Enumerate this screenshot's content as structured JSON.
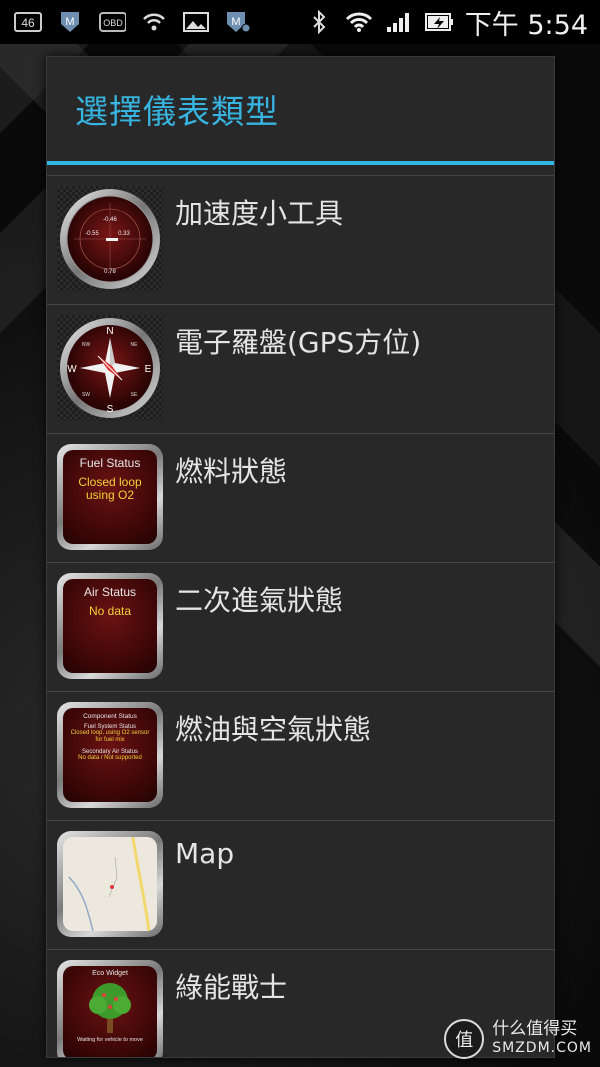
{
  "status_bar": {
    "icons_left": [
      "lte-icon",
      "m-app-icon",
      "obd-icon",
      "wifi-question-icon",
      "image-icon",
      "m-app-badge-icon"
    ],
    "obd_label": "OBD",
    "lte_label": "46",
    "icons_right": [
      "bluetooth-icon",
      "wifi-icon",
      "signal-icon",
      "battery-charging-icon"
    ],
    "time": "下午 5:54"
  },
  "dialog": {
    "title": "選擇儀表類型",
    "items": [
      {
        "label": "加速度小工具",
        "thumb": "accelerometer-gauge",
        "gauge_values": [
          "-0.46",
          "-0.55",
          "0.33",
          "0.78"
        ]
      },
      {
        "label": "電子羅盤(GPS方位)",
        "thumb": "compass-gauge",
        "compass": {
          "n": "N",
          "e": "E",
          "s": "S",
          "w": "W",
          "nw": "NW",
          "ne": "NE",
          "sw": "SW",
          "se": "SE"
        }
      },
      {
        "label": "燃料狀態",
        "thumb": "fuel-status-gauge",
        "gauge_title": "Fuel Status",
        "gauge_text": "Closed loop using O2"
      },
      {
        "label": "二次進氣狀態",
        "thumb": "air-status-gauge",
        "gauge_title": "Air Status",
        "gauge_text": "No data"
      },
      {
        "label": "燃油與空氣狀態",
        "thumb": "component-status-gauge",
        "gauge_title": "Component Status",
        "lines": [
          "Fuel System Status",
          "Closed loop, using O2 sensor for fuel mix",
          "Secondary Air Status",
          "No data / Not supported"
        ]
      },
      {
        "label": "Map",
        "thumb": "map-widget"
      },
      {
        "label": "綠能戰士",
        "thumb": "eco-widget",
        "gauge_title": "Eco Widget",
        "gauge_text": "Waiting for vehicle to move"
      }
    ]
  },
  "watermark": {
    "cn": "什么值得买",
    "en": "SMZDM.COM",
    "logo_char": "值"
  },
  "colors": {
    "accent": "#33b5e5",
    "dialog_bg": "#282828",
    "gauge_yellow": "#f3d23a"
  }
}
